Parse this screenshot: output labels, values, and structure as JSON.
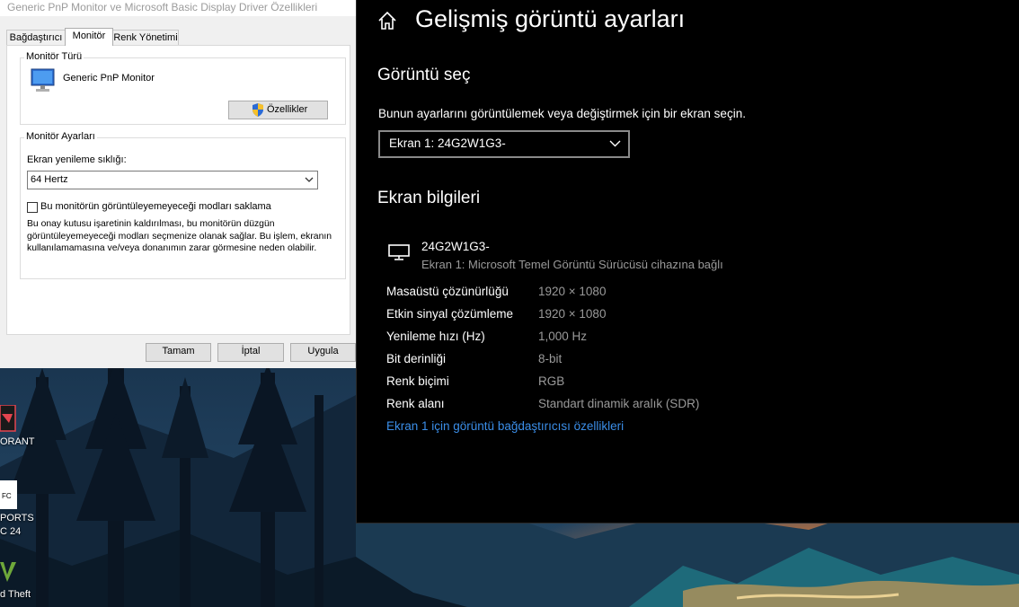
{
  "dialog": {
    "title": "Generic PnP Monitor ve Microsoft Basic Display Driver Özellikleri",
    "tabs": [
      {
        "label": "Bağdaştırıcı"
      },
      {
        "label": "Monitör"
      },
      {
        "label": "Renk Yönetimi"
      }
    ],
    "monitor_type": {
      "legend": "Monitör Türü",
      "name": "Generic PnP Monitor",
      "properties_button": "Özellikler"
    },
    "monitor_settings": {
      "legend": "Monitör Ayarları",
      "refresh_label": "Ekran yenileme sıklığı:",
      "refresh_value": "64 Hertz",
      "hide_modes_label": "Bu monitörün görüntüleyemeyeceği modları saklama",
      "hide_modes_checked": false,
      "description_lines": [
        "Bu onay kutusu işaretinin kaldırılması, bu monitörün düzgün",
        "görüntüleyemeyeceği modları seçmenize olanak sağlar. Bu işlem, ekranın",
        "kullanılamamasına ve/veya donanımın zarar görmesine neden olabilir."
      ]
    },
    "buttons": {
      "ok": "Tamam",
      "cancel": "İptal",
      "apply": "Uygula"
    }
  },
  "desktop": {
    "icons": [
      {
        "label": "ORANT"
      },
      {
        "label_lines": [
          "PORTS",
          "C 24"
        ]
      },
      {
        "label": "d Theft"
      }
    ]
  },
  "settings": {
    "title": "Gelişmiş görüntü ayarları",
    "select_display": {
      "heading": "Görüntü seç",
      "description": "Bunun ayarlarını görüntülemek veya değiştirmek için bir ekran seçin.",
      "selected": "Ekran 1: 24G2W1G3-"
    },
    "display_info": {
      "heading": "Ekran bilgileri",
      "monitor_name": "24G2W1G3-",
      "monitor_subtitle": "Ekran 1: Microsoft Temel Görüntü Sürücüsü cihazına bağlı",
      "rows": [
        {
          "label": "Masaüstü çözünürlüğü",
          "value": "1920 × 1080"
        },
        {
          "label": "Etkin sinyal çözümleme",
          "value": "1920 × 1080"
        },
        {
          "label": "Yenileme hızı (Hz)",
          "value": "1,000 Hz"
        },
        {
          "label": "Bit derinliği",
          "value": "8-bit"
        },
        {
          "label": "Renk biçimi",
          "value": "RGB"
        },
        {
          "label": "Renk alanı",
          "value": "Standart dinamik aralık (SDR)"
        }
      ],
      "adapter_link": "Ekran 1 için görüntü bağdaştırıcısı özellikleri"
    },
    "colors": {
      "background": "#000000",
      "link": "#3b8ee8",
      "secondary_text": "#9a9a9a"
    }
  }
}
